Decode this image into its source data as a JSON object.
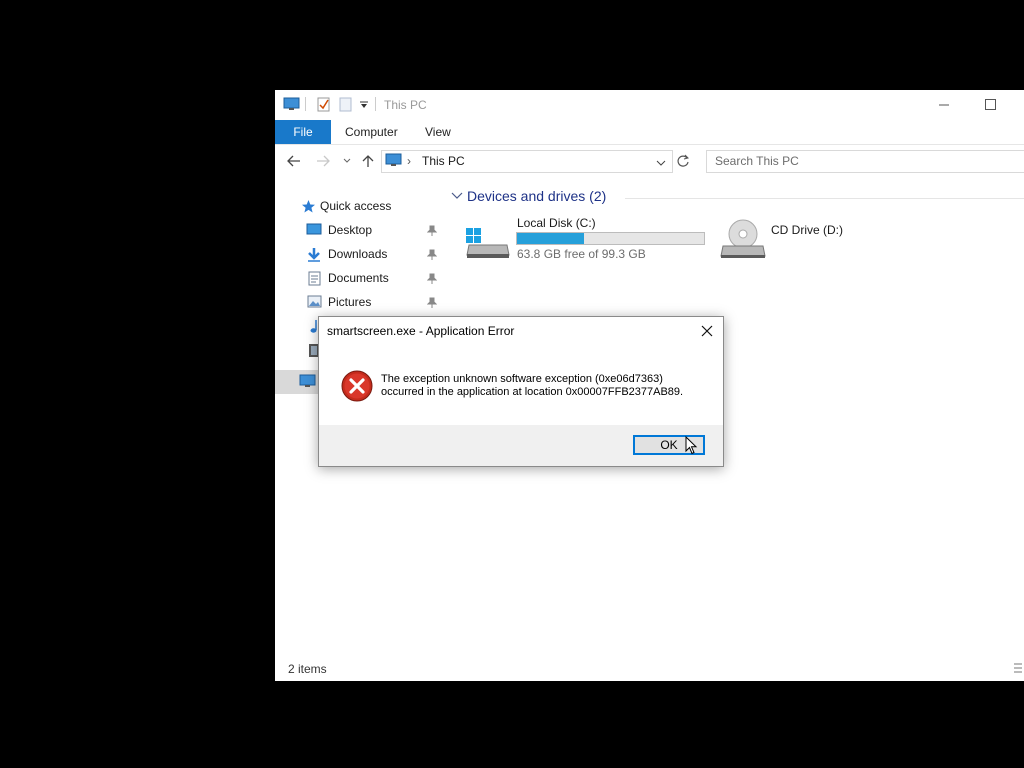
{
  "window": {
    "title": "This PC"
  },
  "ribbon": {
    "tabs": [
      "File",
      "Computer",
      "View"
    ]
  },
  "address": {
    "path": "This PC",
    "search_placeholder": "Search This PC"
  },
  "nav": {
    "items": [
      {
        "label": "Quick access",
        "icon": "star-icon"
      },
      {
        "label": "Desktop",
        "icon": "desktop-icon",
        "pinned": true
      },
      {
        "label": "Downloads",
        "icon": "download-icon",
        "pinned": true
      },
      {
        "label": "Documents",
        "icon": "documents-icon",
        "pinned": true
      },
      {
        "label": "Pictures",
        "icon": "pictures-icon",
        "pinned": true
      }
    ]
  },
  "content": {
    "group_title": "Devices and drives (2)",
    "drives": [
      {
        "name": "Local Disk (C:)",
        "free_text": "63.8 GB free of 99.3 GB",
        "used_fraction": 0.36,
        "icon": "windows-drive-icon"
      },
      {
        "name": "CD Drive (D:)",
        "icon": "cd-drive-icon"
      }
    ]
  },
  "status": {
    "items_text": "2 items"
  },
  "dialog": {
    "title": "smartscreen.exe - Application Error",
    "message_line1": "The exception unknown software exception (0xe06d7363)",
    "message_line2": "occurred in the application at location 0x00007FFB2377AB89.",
    "ok_label": "OK",
    "icon": "error-icon"
  },
  "colors": {
    "accent": "#1979ca",
    "progress": "#26a0da",
    "error": "#c42b1c"
  }
}
